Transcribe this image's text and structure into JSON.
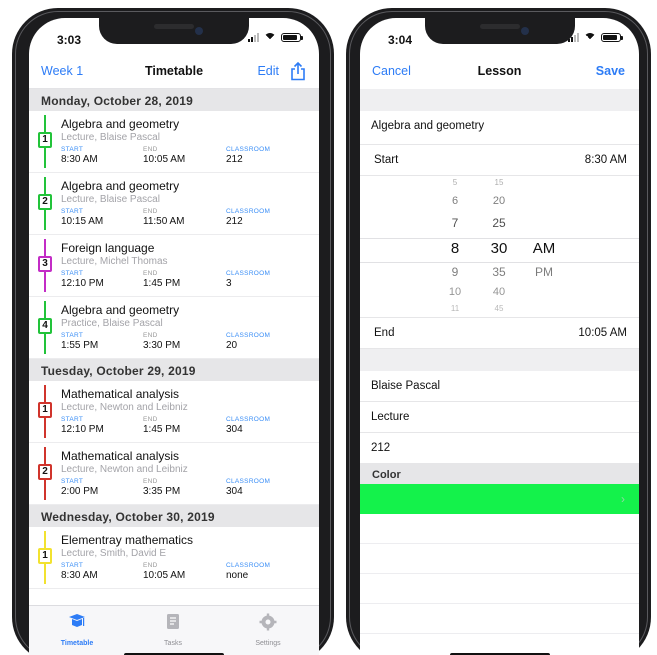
{
  "left_phone": {
    "status_time": "3:03",
    "nav": {
      "left_button": "Week 1",
      "title": "Timetable",
      "right_button": "Edit"
    },
    "labels": {
      "start": "START",
      "end": "END",
      "classroom": "CLASSROOM"
    },
    "days": [
      {
        "header": "Monday, October 28, 2019",
        "lessons": [
          {
            "number": "1",
            "color": "#22c33a",
            "subject": "Algebra and geometry",
            "kind": "Lecture, Blaise Pascal",
            "start": "8:30 AM",
            "end": "10:05 AM",
            "classroom": "212"
          },
          {
            "number": "2",
            "color": "#22c33a",
            "subject": "Algebra and geometry",
            "kind": "Lecture, Blaise Pascal",
            "start": "10:15 AM",
            "end": "11:50 AM",
            "classroom": "212"
          },
          {
            "number": "3",
            "color": "#c32cc6",
            "subject": "Foreign language",
            "kind": "Lecture, Michel Thomas",
            "start": "12:10 PM",
            "end": "1:45 PM",
            "classroom": "3"
          },
          {
            "number": "4",
            "color": "#22c33a",
            "subject": "Algebra and geometry",
            "kind": "Practice, Blaise Pascal",
            "start": "1:55 PM",
            "end": "3:30 PM",
            "classroom": "20"
          }
        ]
      },
      {
        "header": "Tuesday, October 29, 2019",
        "lessons": [
          {
            "number": "1",
            "color": "#d0342c",
            "subject": "Mathematical analysis",
            "kind": "Lecture, Newton and Leibniz",
            "start": "12:10 PM",
            "end": "1:45 PM",
            "classroom": "304"
          },
          {
            "number": "2",
            "color": "#d0342c",
            "subject": "Mathematical analysis",
            "kind": "Lecture, Newton and Leibniz",
            "start": "2:00 PM",
            "end": "3:35 PM",
            "classroom": "304"
          }
        ]
      },
      {
        "header": "Wednesday, October 30, 2019",
        "lessons": [
          {
            "number": "1",
            "color": "#f2e230",
            "subject": "Elementray mathematics",
            "kind": "Lecture, Smith, David E",
            "start": "8:30 AM",
            "end": "10:05 AM",
            "classroom": "none"
          }
        ]
      }
    ],
    "tabs": [
      {
        "label": "Timetable",
        "icon": "graduation-cap-icon",
        "active": true
      },
      {
        "label": "Tasks",
        "icon": "tasks-icon",
        "active": false
      },
      {
        "label": "Settings",
        "icon": "settings-icon",
        "active": false
      }
    ]
  },
  "right_phone": {
    "status_time": "3:04",
    "nav": {
      "left_button": "Cancel",
      "title": "Lesson",
      "right_button": "Save"
    },
    "subject": "Algebra and geometry",
    "start_label": "Start",
    "start_value": "8:30 AM",
    "picker": {
      "hours": [
        "5",
        "6",
        "7",
        "8",
        "9",
        "10",
        "11"
      ],
      "minutes": [
        "15",
        "20",
        "25",
        "30",
        "35",
        "40",
        "45"
      ],
      "periods": [
        "AM",
        "PM"
      ]
    },
    "end_label": "End",
    "end_value": "10:05 AM",
    "teacher": "Blaise Pascal",
    "type": "Lecture",
    "classroom": "212",
    "color_section": "Color",
    "color_value": "#14f24b"
  }
}
